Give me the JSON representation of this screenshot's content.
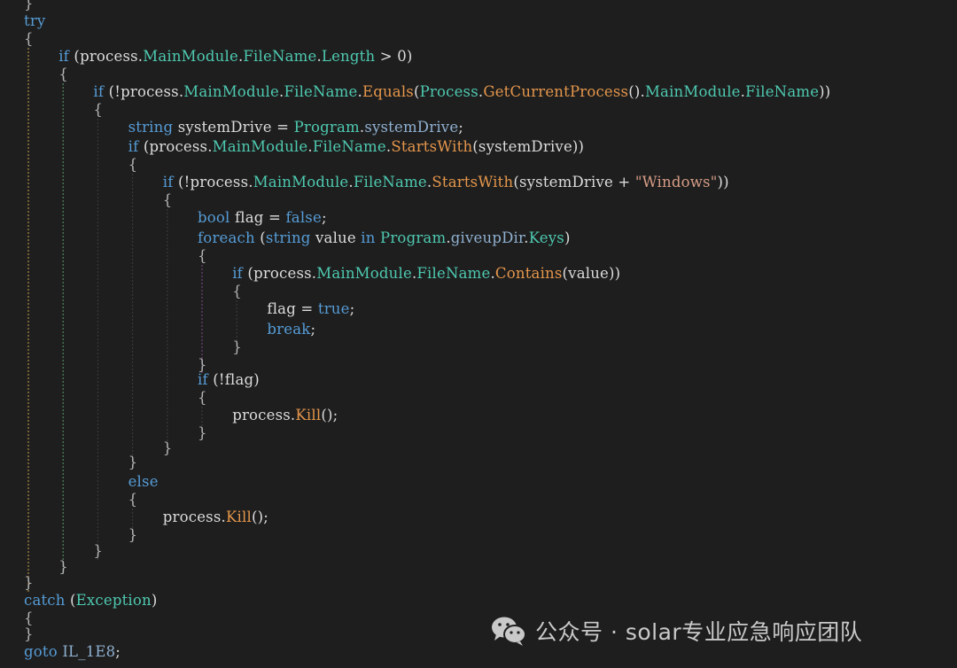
{
  "editor": {
    "background": "#1e1e1e",
    "lines": [
      {
        "indent": 0,
        "tokens": [
          {
            "t": "}",
            "c": "pn"
          }
        ]
      },
      {
        "indent": 0,
        "tokens": [
          {
            "t": "try",
            "c": "kw"
          }
        ]
      },
      {
        "indent": 0,
        "tokens": [
          {
            "t": "{",
            "c": "pn"
          }
        ]
      },
      {
        "indent": 1,
        "tokens": [
          {
            "t": "if",
            "c": "kw"
          },
          {
            "t": " (process.",
            "c": "id"
          },
          {
            "t": "MainModule",
            "c": "mem"
          },
          {
            "t": ".",
            "c": "id"
          },
          {
            "t": "FileName",
            "c": "mem"
          },
          {
            "t": ".",
            "c": "id"
          },
          {
            "t": "Length",
            "c": "mem"
          },
          {
            "t": " > 0)",
            "c": "id"
          }
        ]
      },
      {
        "indent": 1,
        "tokens": [
          {
            "t": "{",
            "c": "pn"
          }
        ]
      },
      {
        "indent": 2,
        "tokens": [
          {
            "t": "if",
            "c": "kw"
          },
          {
            "t": " (!process.",
            "c": "id"
          },
          {
            "t": "MainModule",
            "c": "mem"
          },
          {
            "t": ".",
            "c": "id"
          },
          {
            "t": "FileName",
            "c": "mem"
          },
          {
            "t": ".",
            "c": "id"
          },
          {
            "t": "Equals",
            "c": "meth"
          },
          {
            "t": "(",
            "c": "id"
          },
          {
            "t": "Process",
            "c": "typ"
          },
          {
            "t": ".",
            "c": "id"
          },
          {
            "t": "GetCurrentProcess",
            "c": "meth"
          },
          {
            "t": "().",
            "c": "id"
          },
          {
            "t": "MainModule",
            "c": "mem"
          },
          {
            "t": ".",
            "c": "id"
          },
          {
            "t": "FileName",
            "c": "mem"
          },
          {
            "t": "))",
            "c": "id"
          }
        ]
      },
      {
        "indent": 2,
        "tokens": [
          {
            "t": "{",
            "c": "pn"
          }
        ]
      },
      {
        "indent": 3,
        "tokens": [
          {
            "t": "string",
            "c": "kw"
          },
          {
            "t": " systemDrive = ",
            "c": "id"
          },
          {
            "t": "Program",
            "c": "typ"
          },
          {
            "t": ".",
            "c": "id"
          },
          {
            "t": "systemDrive",
            "c": "fld"
          },
          {
            "t": ";",
            "c": "id"
          }
        ]
      },
      {
        "indent": 3,
        "tokens": [
          {
            "t": "if",
            "c": "kw"
          },
          {
            "t": " (process.",
            "c": "id"
          },
          {
            "t": "MainModule",
            "c": "mem"
          },
          {
            "t": ".",
            "c": "id"
          },
          {
            "t": "FileName",
            "c": "mem"
          },
          {
            "t": ".",
            "c": "id"
          },
          {
            "t": "StartsWith",
            "c": "meth"
          },
          {
            "t": "(systemDrive))",
            "c": "id"
          }
        ]
      },
      {
        "indent": 3,
        "tokens": [
          {
            "t": "{",
            "c": "pn"
          }
        ]
      },
      {
        "indent": 4,
        "tokens": [
          {
            "t": "if",
            "c": "kw"
          },
          {
            "t": " (!process.",
            "c": "id"
          },
          {
            "t": "MainModule",
            "c": "mem"
          },
          {
            "t": ".",
            "c": "id"
          },
          {
            "t": "FileName",
            "c": "mem"
          },
          {
            "t": ".",
            "c": "id"
          },
          {
            "t": "StartsWith",
            "c": "meth"
          },
          {
            "t": "(systemDrive + ",
            "c": "id"
          },
          {
            "t": "\"Windows\"",
            "c": "str"
          },
          {
            "t": "))",
            "c": "id"
          }
        ]
      },
      {
        "indent": 4,
        "tokens": [
          {
            "t": "{",
            "c": "pn"
          }
        ]
      },
      {
        "indent": 5,
        "tokens": [
          {
            "t": "bool",
            "c": "kw"
          },
          {
            "t": " flag = ",
            "c": "id"
          },
          {
            "t": "false",
            "c": "kw"
          },
          {
            "t": ";",
            "c": "id"
          }
        ]
      },
      {
        "indent": 5,
        "tokens": [
          {
            "t": "foreach",
            "c": "kw"
          },
          {
            "t": " (",
            "c": "id"
          },
          {
            "t": "string",
            "c": "kw"
          },
          {
            "t": " value ",
            "c": "id"
          },
          {
            "t": "in",
            "c": "kw"
          },
          {
            "t": " ",
            "c": "id"
          },
          {
            "t": "Program",
            "c": "typ"
          },
          {
            "t": ".",
            "c": "id"
          },
          {
            "t": "giveupDir",
            "c": "fld"
          },
          {
            "t": ".",
            "c": "id"
          },
          {
            "t": "Keys",
            "c": "mem"
          },
          {
            "t": ")",
            "c": "id"
          }
        ]
      },
      {
        "indent": 5,
        "tokens": [
          {
            "t": "{",
            "c": "pn"
          }
        ]
      },
      {
        "indent": 6,
        "tokens": [
          {
            "t": "if",
            "c": "kw"
          },
          {
            "t": " (process.",
            "c": "id"
          },
          {
            "t": "MainModule",
            "c": "mem"
          },
          {
            "t": ".",
            "c": "id"
          },
          {
            "t": "FileName",
            "c": "mem"
          },
          {
            "t": ".",
            "c": "id"
          },
          {
            "t": "Contains",
            "c": "meth"
          },
          {
            "t": "(value))",
            "c": "id"
          }
        ]
      },
      {
        "indent": 6,
        "tokens": [
          {
            "t": "{",
            "c": "pn"
          }
        ]
      },
      {
        "indent": 7,
        "tokens": [
          {
            "t": "flag = ",
            "c": "id"
          },
          {
            "t": "true",
            "c": "kw"
          },
          {
            "t": ";",
            "c": "id"
          }
        ]
      },
      {
        "indent": 7,
        "tokens": [
          {
            "t": "break",
            "c": "kw"
          },
          {
            "t": ";",
            "c": "id"
          }
        ]
      },
      {
        "indent": 6,
        "tokens": [
          {
            "t": "}",
            "c": "pn"
          }
        ]
      },
      {
        "indent": 5,
        "tokens": [
          {
            "t": "}",
            "c": "pn"
          }
        ]
      },
      {
        "indent": 5,
        "tokens": [
          {
            "t": "if",
            "c": "kw"
          },
          {
            "t": " (!flag)",
            "c": "id"
          }
        ]
      },
      {
        "indent": 5,
        "tokens": [
          {
            "t": "{",
            "c": "pn"
          }
        ]
      },
      {
        "indent": 6,
        "tokens": [
          {
            "t": "process.",
            "c": "id"
          },
          {
            "t": "Kill",
            "c": "meth"
          },
          {
            "t": "();",
            "c": "id"
          }
        ]
      },
      {
        "indent": 5,
        "tokens": [
          {
            "t": "}",
            "c": "pn"
          }
        ]
      },
      {
        "indent": 4,
        "tokens": [
          {
            "t": "}",
            "c": "pn"
          }
        ]
      },
      {
        "indent": 3,
        "tokens": [
          {
            "t": "}",
            "c": "pn"
          }
        ]
      },
      {
        "indent": 3,
        "tokens": [
          {
            "t": "else",
            "c": "kw"
          }
        ]
      },
      {
        "indent": 3,
        "tokens": [
          {
            "t": "{",
            "c": "pn"
          }
        ]
      },
      {
        "indent": 4,
        "tokens": [
          {
            "t": "process.",
            "c": "id"
          },
          {
            "t": "Kill",
            "c": "meth"
          },
          {
            "t": "();",
            "c": "id"
          }
        ]
      },
      {
        "indent": 3,
        "tokens": [
          {
            "t": "}",
            "c": "pn"
          }
        ]
      },
      {
        "indent": 2,
        "tokens": [
          {
            "t": "}",
            "c": "pn"
          }
        ]
      },
      {
        "indent": 1,
        "tokens": [
          {
            "t": "}",
            "c": "pn"
          }
        ]
      },
      {
        "indent": 0,
        "tokens": [
          {
            "t": "}",
            "c": "pn"
          }
        ]
      },
      {
        "indent": 0,
        "tokens": [
          {
            "t": "catch",
            "c": "kw"
          },
          {
            "t": " (",
            "c": "id"
          },
          {
            "t": "Exception",
            "c": "typ"
          },
          {
            "t": ")",
            "c": "id"
          }
        ]
      },
      {
        "indent": 0,
        "tokens": [
          {
            "t": "{",
            "c": "pn"
          }
        ]
      },
      {
        "indent": 0,
        "tokens": [
          {
            "t": "}",
            "c": "pn"
          }
        ]
      },
      {
        "indent": 0,
        "tokens": [
          {
            "t": "goto",
            "c": "kw"
          },
          {
            "t": " IL_1E8",
            "c": "fld"
          },
          {
            "t": ";",
            "c": "id"
          }
        ]
      }
    ],
    "guides": [
      {
        "level": 0,
        "from": 3,
        "to": 33,
        "color": "#c8a24a"
      },
      {
        "level": 1,
        "from": 5,
        "to": 32,
        "color": "#5a9a6a"
      },
      {
        "level": 2,
        "from": 7,
        "to": 31,
        "color": "#3e3e3e"
      },
      {
        "level": 3,
        "from": 10,
        "to": 26,
        "color": "#3e3e3e"
      },
      {
        "level": 3,
        "from": 29,
        "to": 30,
        "color": "#3e3e3e"
      },
      {
        "level": 4,
        "from": 12,
        "to": 25,
        "color": "#3e3e3e"
      },
      {
        "level": 5,
        "from": 15,
        "to": 20,
        "color": "#7a4a8a"
      },
      {
        "level": 5,
        "from": 23,
        "to": 24,
        "color": "#3e3e3e"
      },
      {
        "level": 6,
        "from": 17,
        "to": 19,
        "color": "#3e3e3e"
      }
    ]
  },
  "watermark": {
    "icon": "wechat-icon",
    "text": "公众号 · solar专业应急响应团队"
  }
}
